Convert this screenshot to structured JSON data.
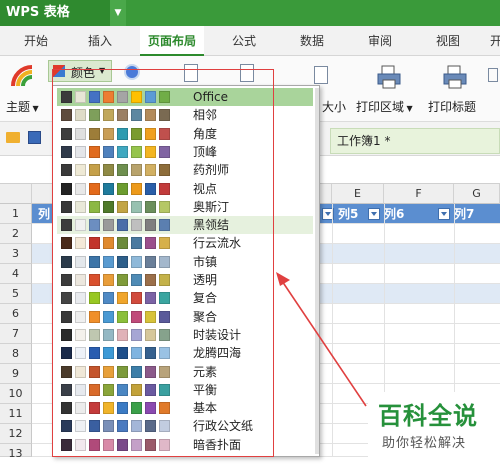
{
  "app": {
    "title": "WPS 表格"
  },
  "tabs": [
    {
      "label": "开始"
    },
    {
      "label": "插入"
    },
    {
      "label": "页面布局"
    },
    {
      "label": "公式"
    },
    {
      "label": "数据"
    },
    {
      "label": "审阅"
    },
    {
      "label": "视图"
    },
    {
      "label": "开"
    }
  ],
  "ribbon": {
    "theme_label": "主题",
    "color_label": "颜色",
    "size_label": "大小",
    "print_area_label": "打印区域",
    "print_title_label": "打印标题"
  },
  "document": {
    "tab_label": "工作簿1 *"
  },
  "grid": {
    "columns": [
      "E",
      "F",
      "G"
    ],
    "header_cells": [
      "列",
      "列5",
      "列6",
      "列7"
    ],
    "rows": [
      "1",
      "2",
      "3",
      "4",
      "5",
      "6",
      "7",
      "8",
      "9",
      "10",
      "11",
      "12",
      "13"
    ]
  },
  "theme_menu": {
    "items": [
      {
        "name": "Office",
        "colors": [
          "#3b3b3b",
          "#e7e6d6",
          "#4472c4",
          "#ed7d31",
          "#a5a5a5",
          "#ffc000",
          "#5b9bd5",
          "#70ad47"
        ]
      },
      {
        "name": "相邻",
        "colors": [
          "#5e4b3c",
          "#dfdcc8",
          "#7e9f5b",
          "#c1a85c",
          "#9c8064",
          "#5d87a1",
          "#b38b5b",
          "#7a6a52"
        ]
      },
      {
        "name": "角度",
        "colors": [
          "#3d3d3d",
          "#e0e0e0",
          "#9d7d39",
          "#c99e57",
          "#2e9bb0",
          "#7a9b2e",
          "#f0a020",
          "#c0504d"
        ]
      },
      {
        "name": "顶峰",
        "colors": [
          "#2f3a4a",
          "#e4e6ea",
          "#e06b1f",
          "#4f81bd",
          "#40a8c0",
          "#96c44d",
          "#f3b522",
          "#8064a2"
        ]
      },
      {
        "name": "药剂师",
        "colors": [
          "#3a3a3a",
          "#eee9d5",
          "#c5a04a",
          "#8f8a45",
          "#6e8f4f",
          "#b8a36c",
          "#d2b062",
          "#8d6d3a"
        ]
      },
      {
        "name": "视点",
        "colors": [
          "#232323",
          "#e8e8e8",
          "#e36a1b",
          "#1f7b9c",
          "#6c9c2f",
          "#ed9a1a",
          "#2a5ea8",
          "#c23b3b"
        ]
      },
      {
        "name": "奥斯汀",
        "colors": [
          "#383838",
          "#e9e9d9",
          "#8cb843",
          "#4f7a2a",
          "#c2a545",
          "#97c1b0",
          "#6b8f5c",
          "#b5c766"
        ]
      },
      {
        "name": "黑领结",
        "colors": [
          "#3c3c3c",
          "#f0f0f0",
          "#6c8ec0",
          "#9a9a9a",
          "#4a6ea8",
          "#bfbfbf",
          "#7f7f7f",
          "#5b7fb0"
        ]
      },
      {
        "name": "行云流水",
        "colors": [
          "#4a2a1a",
          "#f4e9d8",
          "#c2342b",
          "#e08a2e",
          "#6d8b3a",
          "#4b7aa0",
          "#9b4f8c",
          "#d6b04a"
        ]
      },
      {
        "name": "市镇",
        "colors": [
          "#2b3b4b",
          "#e4e8ec",
          "#3d75a8",
          "#5a9bd0",
          "#2e5f8a",
          "#8fb9d9",
          "#6a7f99",
          "#a3b7cc"
        ]
      },
      {
        "name": "透明",
        "colors": [
          "#3c3c3c",
          "#ece7de",
          "#d9502e",
          "#e89d3a",
          "#7f9b3a",
          "#4f8bb5",
          "#9b6f4a",
          "#c4b24a"
        ]
      },
      {
        "name": "复合",
        "colors": [
          "#444444",
          "#e9ebef",
          "#98c723",
          "#4f8ac5",
          "#f0a52b",
          "#d14b3d",
          "#7b63a5",
          "#3aa5a0"
        ]
      },
      {
        "name": "聚合",
        "colors": [
          "#3a3a3a",
          "#efefef",
          "#f08f2a",
          "#4a9ad4",
          "#8bbf3a",
          "#c04b7a",
          "#d7c23a",
          "#5a5a9a"
        ]
      },
      {
        "name": "时装设计",
        "colors": [
          "#2a2a2a",
          "#f4f1ec",
          "#bfc7b0",
          "#94b8c4",
          "#e0b2b8",
          "#a6a6d4",
          "#d6c79a",
          "#86a28c"
        ]
      },
      {
        "name": "龙腾四海",
        "colors": [
          "#1a2a4a",
          "#eef2f8",
          "#2a5db0",
          "#3e9ad6",
          "#1e4f8a",
          "#7fb4e0",
          "#36618f",
          "#9ac2e4"
        ]
      },
      {
        "name": "元素",
        "colors": [
          "#4b3b2b",
          "#f0e8d8",
          "#c4552d",
          "#e7a03a",
          "#7c9a3b",
          "#3d7ea8",
          "#8b5a8a",
          "#b8a37a"
        ]
      },
      {
        "name": "平衡",
        "colors": [
          "#3a3f48",
          "#e6e9ee",
          "#d96a2a",
          "#8aa53a",
          "#4a86c2",
          "#c2a23a",
          "#6a5aa0",
          "#3aa0a0"
        ]
      },
      {
        "name": "基本",
        "colors": [
          "#333333",
          "#ececec",
          "#c43b3b",
          "#f0b42a",
          "#3b7bc4",
          "#3ba04a",
          "#8a4ab0",
          "#e07a2a"
        ]
      },
      {
        "name": "行政公文纸",
        "colors": [
          "#2a3a5a",
          "#eef0f4",
          "#3a5fa0",
          "#7a8fb8",
          "#4a7ac0",
          "#a4b6d8",
          "#5a6a8a",
          "#c2cce0"
        ]
      },
      {
        "name": "暗香扑面",
        "colors": [
          "#3a2a3a",
          "#f2e8ee",
          "#b04a7a",
          "#d88aa8",
          "#7a4a8a",
          "#c4a0c8",
          "#9a5a6a",
          "#e0b8c8"
        ]
      }
    ],
    "selected": "Office",
    "hovered": "黑领结"
  },
  "watermark": {
    "title": "百科全说",
    "subtitle": "助你轻松解决"
  }
}
